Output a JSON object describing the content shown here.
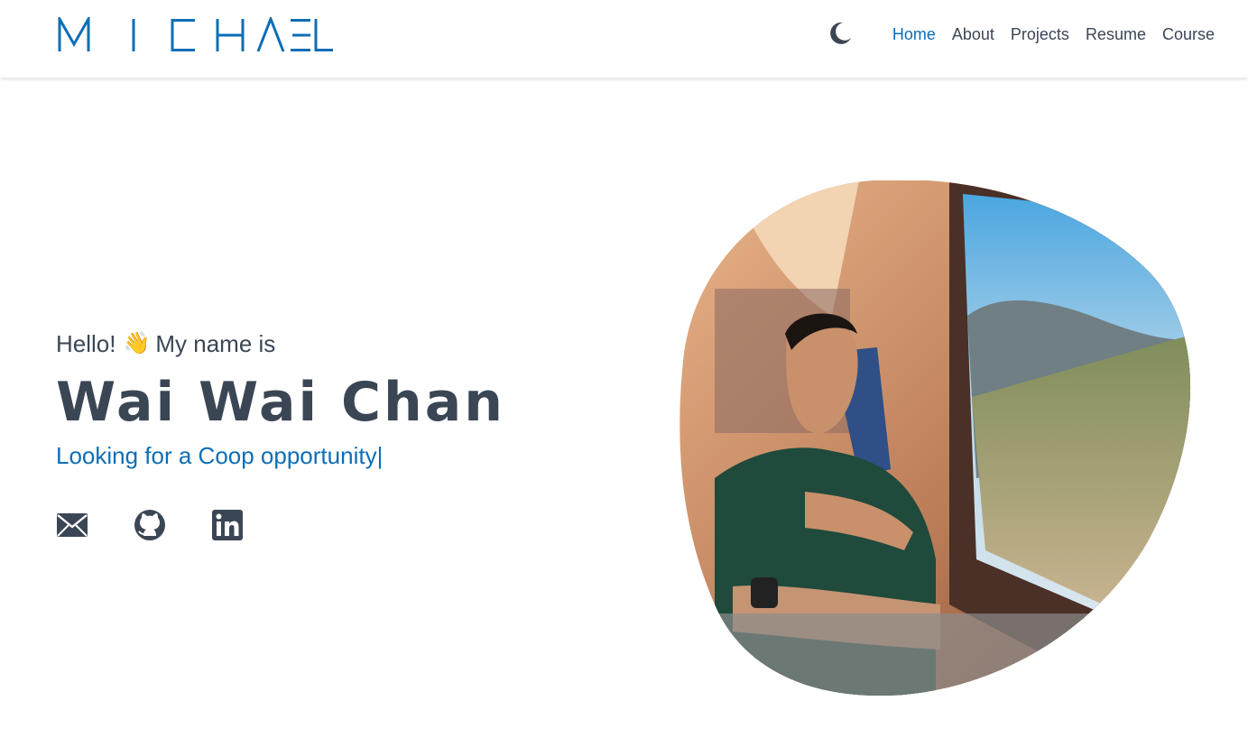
{
  "header": {
    "logo_text": "MICHAEL",
    "nav": [
      {
        "label": "Home",
        "active": true
      },
      {
        "label": "About",
        "active": false
      },
      {
        "label": "Projects",
        "active": false
      },
      {
        "label": "Resume",
        "active": false
      },
      {
        "label": "Course",
        "active": false
      }
    ],
    "theme_toggle_icon": "moon-icon"
  },
  "hero": {
    "greeting_prefix": "Hello!",
    "greeting_emoji": "👋",
    "greeting_suffix": "My name is",
    "name": "Wai Wai Chan",
    "tagline": "Looking for a Coop opportunity",
    "cursor": "|",
    "socials": [
      {
        "icon": "envelope-icon"
      },
      {
        "icon": "github-icon"
      },
      {
        "icon": "linkedin-icon"
      }
    ]
  },
  "colors": {
    "accent": "#0d6eb5",
    "text": "#3b4655",
    "background": "#ffffff"
  }
}
